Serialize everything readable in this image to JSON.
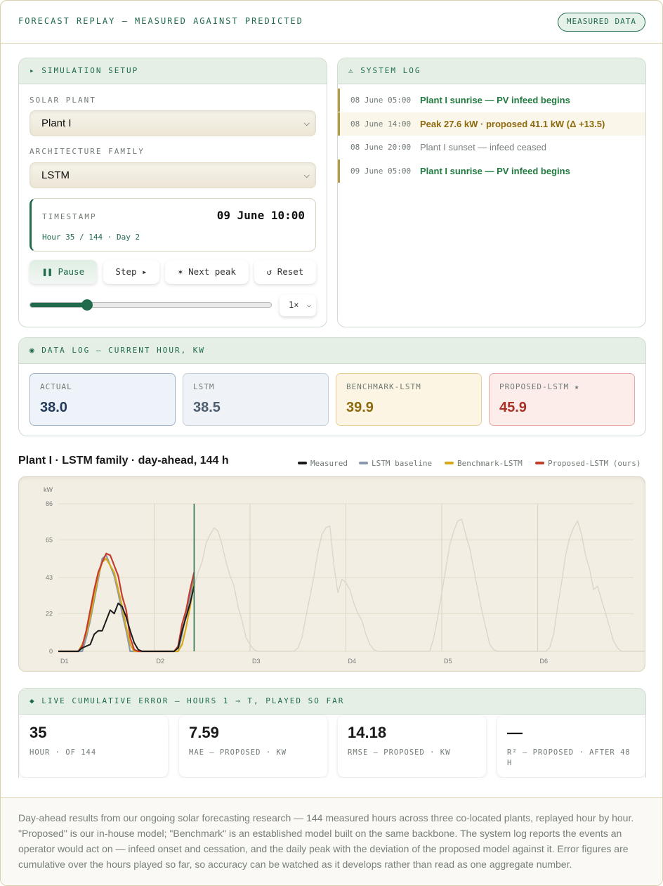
{
  "header": {
    "title": "FORECAST REPLAY — MEASURED AGAINST PREDICTED",
    "badge": "MEASURED DATA"
  },
  "setup": {
    "heading": "▸ SIMULATION SETUP",
    "plant_label": "SOLAR PLANT",
    "plant_value": "Plant I",
    "arch_label": "ARCHITECTURE FAMILY",
    "arch_value": "LSTM",
    "timestamp_label": "TIMESTAMP",
    "timestamp_value": "09 June 10:00",
    "timestamp_sub": "Hour 35 / 144 · Day 2",
    "buttons": {
      "pause": "❚❚ Pause",
      "step": "Step ▸",
      "next_peak": "✶ Next peak",
      "reset": "↺ Reset"
    },
    "progress_fraction": 0.236,
    "speed": "1×"
  },
  "log": {
    "heading": "⚠ SYSTEM LOG",
    "entries": [
      {
        "time": "08 June 05:00",
        "msg": "Plant I sunrise — PV infeed begins",
        "kind": "green"
      },
      {
        "time": "08 June 14:00",
        "msg": "Peak 27.6 kW · proposed 41.1 kW (Δ +13.5)",
        "kind": "amber"
      },
      {
        "time": "08 June 20:00",
        "msg": "Plant I sunset — infeed ceased",
        "kind": "gray"
      },
      {
        "time": "09 June 05:00",
        "msg": "Plant I sunrise — PV infeed begins",
        "kind": "green"
      }
    ]
  },
  "datalog": {
    "heading": "◉ DATA LOG — CURRENT HOUR, KW",
    "cards": [
      {
        "label": "ACTUAL",
        "value": "38.0"
      },
      {
        "label": "LSTM",
        "value": "38.5"
      },
      {
        "label": "BENCHMARK-LSTM",
        "value": "39.9"
      },
      {
        "label": "PROPOSED-LSTM ★",
        "value": "45.9"
      }
    ]
  },
  "chart": {
    "title": "Plant I · LSTM family · day-ahead, 144 h",
    "legend": [
      "Measured",
      "LSTM baseline",
      "Benchmark-LSTM",
      "Proposed-LSTM (ours)"
    ],
    "colors": {
      "measured": "#1a1a1a",
      "lstm": "#8b9aaa",
      "bench": "#d4aa1a",
      "proposed": "#c43c2e",
      "future": "#d9d5c8",
      "cursor": "#1f6b4c"
    }
  },
  "chart_data": {
    "type": "line",
    "title": "Plant I · LSTM family · day-ahead, 144 h",
    "ylabel": "kW",
    "xlabel": "",
    "x_range": [
      0,
      144
    ],
    "ylim": [
      0,
      86
    ],
    "y_ticks": [
      0,
      22,
      43,
      65,
      86
    ],
    "x_tick_labels": [
      "D1",
      "D2",
      "D3",
      "D4",
      "D5",
      "D6"
    ],
    "x_tick_hours": [
      0,
      24,
      48,
      72,
      96,
      120
    ],
    "current_hour": 34,
    "legend_position": "top-right",
    "series": [
      {
        "name": "Measured",
        "color": "#1a1a1a",
        "values": [
          0,
          0,
          0,
          0,
          0,
          0,
          2,
          3,
          4,
          10,
          12,
          12,
          18,
          24,
          22,
          28,
          26,
          20,
          12,
          5,
          1,
          0,
          0,
          0,
          0,
          0,
          0,
          0,
          0,
          0,
          2,
          12,
          20,
          28,
          38
        ]
      },
      {
        "name": "LSTM baseline",
        "color": "#8b9aaa",
        "values": [
          0,
          0,
          0,
          0,
          0,
          0,
          0,
          8,
          18,
          30,
          42,
          54,
          56,
          50,
          44,
          34,
          22,
          12,
          0,
          0,
          0,
          0,
          0,
          0,
          0,
          0,
          0,
          0,
          0,
          0,
          0,
          10,
          22,
          32,
          43
        ]
      },
      {
        "name": "Benchmark-LSTM",
        "color": "#d4aa1a",
        "values": [
          0,
          0,
          0,
          0,
          0,
          0,
          4,
          10,
          20,
          32,
          44,
          52,
          54,
          50,
          46,
          36,
          26,
          14,
          4,
          0,
          0,
          0,
          0,
          0,
          0,
          0,
          0,
          0,
          0,
          0,
          0,
          4,
          14,
          26,
          40
        ]
      },
      {
        "name": "Proposed-LSTM (ours)",
        "color": "#c43c2e",
        "values": [
          0,
          0,
          0,
          0,
          0,
          0,
          3,
          12,
          24,
          36,
          46,
          52,
          57,
          56,
          50,
          44,
          32,
          24,
          8,
          1,
          0,
          0,
          0,
          0,
          0,
          0,
          0,
          0,
          0,
          0,
          3,
          16,
          24,
          36,
          46
        ]
      },
      {
        "name": "Measured (remaining hours)",
        "color": "#d9d5c8",
        "values": [
          38,
          46,
          52,
          63,
          68,
          72,
          70,
          62,
          52,
          44,
          38,
          26,
          18,
          8,
          4,
          1,
          0,
          0,
          0,
          0,
          0,
          0,
          0,
          0,
          0,
          0,
          2,
          8,
          20,
          32,
          44,
          58,
          68,
          72,
          73,
          50,
          34,
          42,
          40,
          36,
          28,
          22,
          18,
          10,
          4,
          1,
          0,
          0,
          0,
          0,
          0,
          0,
          0,
          0,
          0,
          0,
          0,
          0,
          0,
          0,
          8,
          20,
          34,
          48,
          62,
          70,
          76,
          77,
          68,
          60,
          48,
          36,
          24,
          14,
          4,
          1,
          0,
          0,
          0,
          0,
          0,
          0,
          0,
          0,
          0,
          0,
          0,
          0,
          0,
          2,
          10,
          26,
          40,
          56,
          66,
          72,
          76,
          68,
          56,
          48,
          36,
          38,
          30,
          22,
          14,
          6,
          2,
          0,
          0,
          0,
          0,
          0,
          0,
          0,
          0,
          0,
          0,
          0,
          0,
          0,
          4,
          14,
          28,
          44,
          58,
          70,
          74,
          76,
          72,
          64,
          52,
          42,
          30,
          18,
          8,
          2,
          0,
          0,
          0,
          0,
          0
        ]
      }
    ]
  },
  "errors": {
    "heading": "◆ LIVE CUMULATIVE ERROR — HOURS 1 → T, PLAYED SO FAR",
    "stats": [
      {
        "value": "35",
        "label": "HOUR · OF 144"
      },
      {
        "value": "7.59",
        "label": "MAE — PROPOSED · KW"
      },
      {
        "value": "14.18",
        "label": "RMSE — PROPOSED · KW"
      },
      {
        "value": "—",
        "label": "R² — PROPOSED · AFTER 48 H"
      }
    ]
  },
  "footer": {
    "text": "Day-ahead results from our ongoing solar forecasting research — 144 measured hours across three co-located plants, replayed hour by hour. \"Proposed\" is our in-house model; \"Benchmark\" is an established model built on the same backbone. The system log reports the events an operator would act on — infeed onset and cessation, and the daily peak with the deviation of the proposed model against it. Error figures are cumulative over the hours played so far, so accuracy can be watched as it develops rather than read as one aggregate number."
  }
}
